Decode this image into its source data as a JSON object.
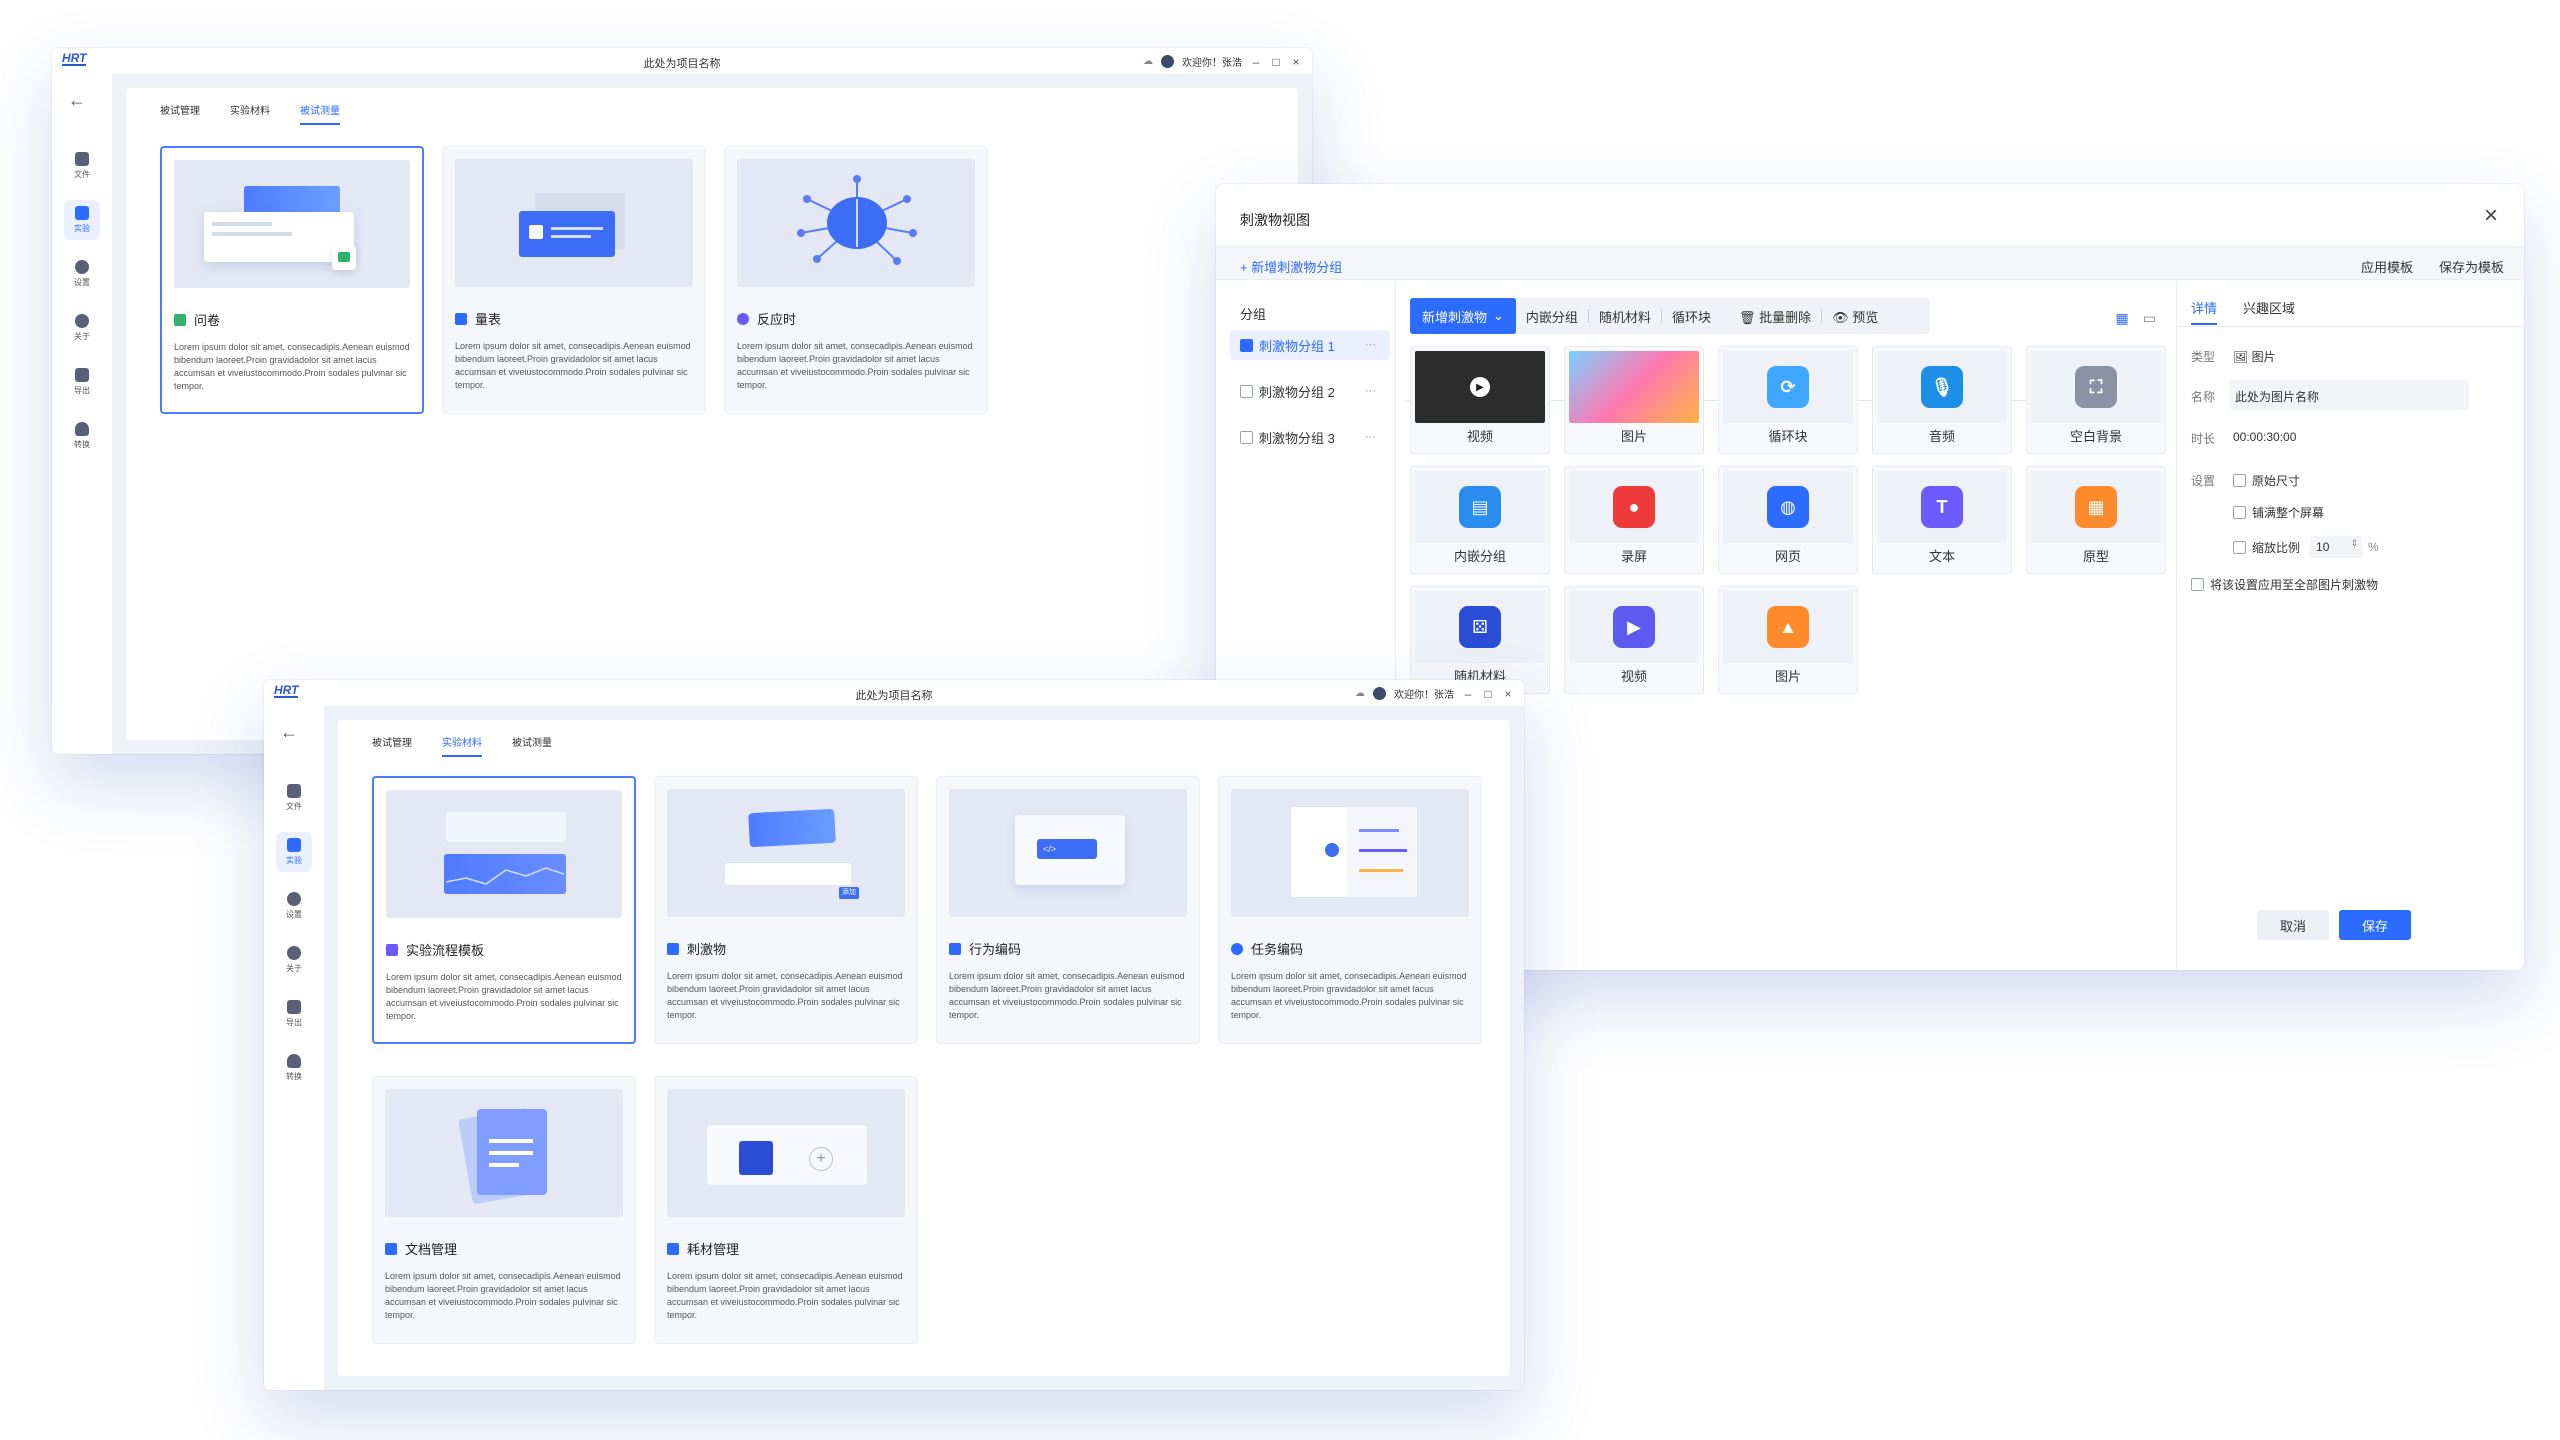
{
  "app": {
    "logo": "HRT",
    "project_title": "此处为项目名称",
    "welcome": "欢迎你！张浩"
  },
  "nav": {
    "items": [
      {
        "label": "文件"
      },
      {
        "label": "实验"
      },
      {
        "label": "设置"
      },
      {
        "label": "关于"
      },
      {
        "label": "导出"
      },
      {
        "label": "转换"
      }
    ]
  },
  "win1": {
    "tabs": [
      "被试管理",
      "实验材料",
      "被试测量"
    ],
    "active_tab": 2,
    "cards": [
      {
        "title": "问卷",
        "desc": "Lorem ipsum dolor sit amet, consecadipis.Aenean euismod bibendum laoreet.Proin gravidadolor sit amet lacus accumsan et viveiustocommodo.Proin sodales pulvinar sic tempor.",
        "icon_color": "#2fb36a"
      },
      {
        "title": "量表",
        "desc": "Lorem ipsum dolor sit amet, consecadipis.Aenean euismod bibendum laoreet.Proin gravidadolor sit amet lacus accumsan et viveiustocommodo.Proin sodales pulvinar sic tempor.",
        "icon_color": "#2b6bff"
      },
      {
        "title": "反应时",
        "desc": "Lorem ipsum dolor sit amet, consecadipis.Aenean euismod bibendum laoreet.Proin gravidadolor sit amet lacus accumsan et viveiustocommodo.Proin sodales pulvinar sic tempor.",
        "icon_color": "#6b5bff"
      }
    ]
  },
  "win2": {
    "tabs": [
      "被试管理",
      "实验材料",
      "被试测量"
    ],
    "active_tab": 1,
    "cards": [
      {
        "title": "实验流程模板",
        "desc": "Lorem ipsum dolor sit amet, consecadipis.Aenean euismod bibendum laoreet.Proin gravidadolor sit amet lacus accumsan et viveiustocommodo.Proin sodales pulvinar sic tempor."
      },
      {
        "title": "刺激物",
        "desc": "Lorem ipsum dolor sit amet, consecadipis.Aenean euismod bibendum laoreet.Proin gravidadolor sit amet lacus accumsan et viveiustocommodo.Proin sodales pulvinar sic tempor."
      },
      {
        "title": "行为编码",
        "desc": "Lorem ipsum dolor sit amet, consecadipis.Aenean euismod bibendum laoreet.Proin gravidadolor sit amet lacus accumsan et viveiustocommodo.Proin sodales pulvinar sic tempor."
      },
      {
        "title": "任务编码",
        "desc": "Lorem ipsum dolor sit amet, consecadipis.Aenean euismod bibendum laoreet.Proin gravidadolor sit amet lacus accumsan et viveiustocommodo.Proin sodales pulvinar sic tempor."
      },
      {
        "title": "文档管理",
        "desc": "Lorem ipsum dolor sit amet, consecadipis.Aenean euismod bibendum laoreet.Proin gravidadolor sit amet lacus accumsan et viveiustocommodo.Proin sodales pulvinar sic tempor."
      },
      {
        "title": "耗材管理",
        "desc": "Lorem ipsum dolor sit amet, consecadipis.Aenean euismod bibendum laoreet.Proin gravidadolor sit amet lacus accumsan et viveiustocommodo.Proin sodales pulvinar sic tempor."
      }
    ],
    "badge": "添加"
  },
  "dialog": {
    "title": "刺激物视图",
    "add_group": "+ 新增刺激物分组",
    "apply_template": "应用模板",
    "save_template": "保存为模板",
    "group_header": "分组",
    "groups": [
      "刺激物分组 1",
      "刺激物分组 2",
      "刺激物分组 3"
    ],
    "toolbar": {
      "add": "新增刺激物",
      "embed": "内嵌分组",
      "random": "随机材料",
      "loop": "循环块",
      "batch_delete": "批量删除",
      "preview": "预览"
    },
    "tiles": [
      {
        "label": "视频",
        "color": "#222"
      },
      {
        "label": "图片",
        "color": "#ff6aa0"
      },
      {
        "label": "循环块",
        "color": "#3fa7ff"
      },
      {
        "label": "音频",
        "color": "#1d8fe8"
      },
      {
        "label": "空白背景",
        "color": "#8a93a6"
      },
      {
        "label": "内嵌分组",
        "color": "#2b8cf0"
      },
      {
        "label": "录屏",
        "color": "#ef3a3a"
      },
      {
        "label": "网页",
        "color": "#2b6bff"
      },
      {
        "label": "文本",
        "color": "#6b5bff"
      },
      {
        "label": "原型",
        "color": "#ff8a2b"
      },
      {
        "label": "随机材料",
        "color": "#2a4dd6"
      },
      {
        "label": "视频",
        "color": "#5b5bf0"
      },
      {
        "label": "图片",
        "color": "#ff8a2b"
      }
    ],
    "right_tabs": [
      "详情",
      "兴趣区域"
    ],
    "props": {
      "type_label": "类型",
      "type_value": "图片",
      "name_label": "名称",
      "name_value": "此处为图片名称",
      "duration_label": "时长",
      "duration_value": "00:00:30:00",
      "settings_label": "设置",
      "opt_original": "原始尺寸",
      "opt_fill": "铺满整个屏幕",
      "opt_scale": "缩放比例",
      "scale_value": "10",
      "scale_unit": "%",
      "apply_all": "将该设置应用至全部图片刺激物"
    },
    "cancel": "取消",
    "save": "保存"
  },
  "colors": {
    "accent": "#2b6bff"
  }
}
